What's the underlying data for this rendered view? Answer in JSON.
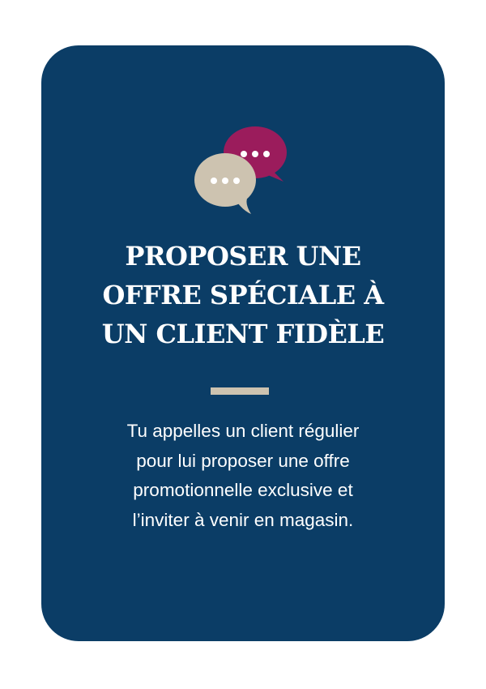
{
  "card": {
    "background_color": "#0b3d66",
    "icon": "speech-bubbles-icon",
    "icon_colors": {
      "back_bubble": "#9b1c5c",
      "front_bubble": "#cdc3b0",
      "dots": "#ffffff"
    },
    "title_lines": [
      "PROPOSER UNE",
      "OFFRE SPÉCIALE À",
      "UN CLIENT FIDÈLE"
    ],
    "divider_color": "#cdc3b0",
    "description_lines": [
      "Tu appelles un client régulier",
      "pour lui proposer une offre",
      "promotionnelle exclusive et",
      "l’inviter à venir en magasin."
    ]
  }
}
